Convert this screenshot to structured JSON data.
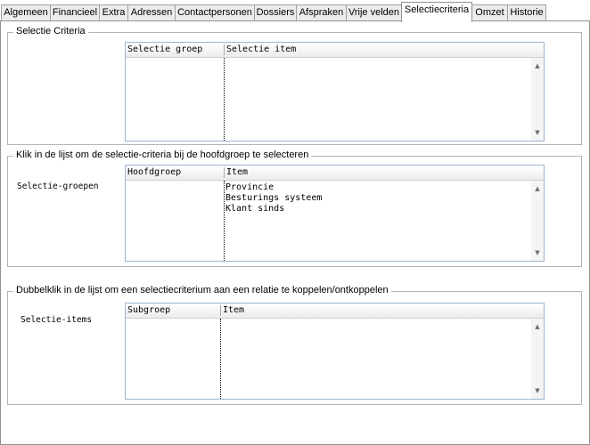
{
  "tabs": [
    {
      "label": "Algemeen"
    },
    {
      "label": "Financieel"
    },
    {
      "label": "Extra"
    },
    {
      "label": "Adressen"
    },
    {
      "label": "Contactpersonen"
    },
    {
      "label": "Dossiers"
    },
    {
      "label": "Afspraken"
    },
    {
      "label": "Vrije velden"
    },
    {
      "label": "Selectiecriteria",
      "active": true
    },
    {
      "label": "Omzet"
    },
    {
      "label": "Historie"
    }
  ],
  "section1": {
    "title": "Selectie Criteria",
    "columns": [
      "Selectie groep",
      "Selectie item"
    ],
    "rows": []
  },
  "section2": {
    "title": "Klik in de lijst om de selectie-criteria bij de hoofdgroep te selecteren",
    "side_label": "Selectie-groepen",
    "columns": [
      "Hoofdgroep",
      "Item"
    ],
    "rows": [
      "Provincie",
      "Besturings systeem",
      "Klant sinds"
    ]
  },
  "section3": {
    "title": "Dubbelklik in de lijst om een selectiecriterium aan een relatie te koppelen/ontkoppelen",
    "side_label": "Selectie-items",
    "columns": [
      "Subgroep",
      "Item"
    ],
    "rows": []
  }
}
